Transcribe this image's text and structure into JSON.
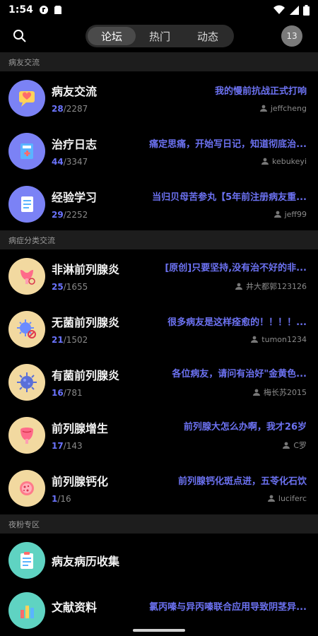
{
  "status_bar": {
    "time": "1:54"
  },
  "tabs": [
    {
      "label": "论坛",
      "active": true
    },
    {
      "label": "热门",
      "active": false
    },
    {
      "label": "动态",
      "active": false
    }
  ],
  "avatar_text": "13",
  "sections": [
    {
      "title": "病友交流",
      "rows": [
        {
          "name": "病友交流",
          "today": "28",
          "total": "/2287",
          "latest": "我的慢前抗战正式打响",
          "user": "jeffcheng",
          "icon": "chat-heart-icon"
        },
        {
          "name": "治疗日志",
          "today": "44",
          "total": "/3347",
          "latest": "痛定思痛，开始写日记，知道彻底治...",
          "user": "kebukeyi",
          "icon": "medical-notebook-icon"
        },
        {
          "name": "经验学习",
          "today": "29",
          "total": "/2252",
          "latest": "当归贝母苦参丸【5年前注册病友重...",
          "user": "jeff99",
          "icon": "document-list-icon"
        }
      ]
    },
    {
      "title": "病症分类交流",
      "rows": [
        {
          "name": "非淋前列腺炎",
          "today": "25",
          "total": "/1655",
          "latest": "[原创]只要坚持,没有治不好的非...",
          "user": "井大都郭123126",
          "icon": "inflamed-gland-icon"
        },
        {
          "name": "无菌前列腺炎",
          "today": "21",
          "total": "/1502",
          "latest": "很多病友是这样痊愈的！！！！...",
          "user": "tumon1234",
          "icon": "no-bacteria-icon"
        },
        {
          "name": "有菌前列腺炎",
          "today": "16",
          "total": "/781",
          "latest": "各位病友，请问有治好\"金黄色...",
          "user": "梅长苏2015",
          "icon": "bacteria-icon"
        },
        {
          "name": "前列腺增生",
          "today": "17",
          "total": "/143",
          "latest": "前列腺大怎么办啊，我才26岁",
          "user": "C罗",
          "icon": "enlarged-gland-icon"
        },
        {
          "name": "前列腺钙化",
          "today": "1",
          "total": "/16",
          "latest": "前列腺钙化斑点进，五苓化石饮",
          "user": "luciferc",
          "icon": "calcification-icon"
        }
      ]
    },
    {
      "title": "夜粉专区",
      "rows": [
        {
          "name": "病友病历收集",
          "today": "",
          "total": "",
          "latest": "",
          "user": "",
          "icon": "clipboard-icon"
        },
        {
          "name": "文献资料",
          "today": "",
          "total": "",
          "latest": "氯丙嗪与异丙嗪联合应用导致阴茎异...",
          "user": "",
          "icon": "bar-chart-icon"
        }
      ]
    }
  ],
  "colors": {
    "accent": "#6c72f2",
    "count": "#6b74ff",
    "section_bg": "#1d1d1d"
  }
}
